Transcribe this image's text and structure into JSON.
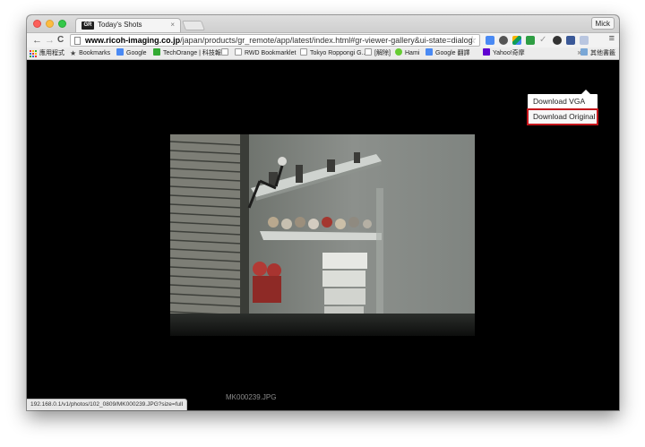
{
  "browser": {
    "tab_title": "Today's Shots",
    "tab_favicon_text": "GR",
    "tab_close": "×",
    "profile_name": "Mick",
    "url_host": "www.ricoh-imaging.co.jp",
    "url_path": "/japan/products/gr_remote/app/latest/index.html#gr-viewer-gallery&ui-state=dialog",
    "status_url": "192.168.0.1/v1/photos/102_0809/MK000239.JPG?size=full"
  },
  "bookmarks": {
    "items": [
      "應用程式",
      "Bookmarks",
      "Google",
      "TechOrange | 科技報",
      "",
      "RWD Bookmarklet",
      "Tokyo Roppongi G...",
      "[解除]",
      "Hami",
      "Google 翻譯",
      "Yahoo!奇摩"
    ],
    "overflow": "»",
    "other": "其他書籤"
  },
  "viewer": {
    "filename": "MK000239.JPG",
    "menu": {
      "items": [
        "Download VGA",
        "Download Original"
      ],
      "selected": "Download Original"
    }
  },
  "colors": {
    "highlight": "#c4161c",
    "viewer_bg": "#000000"
  }
}
